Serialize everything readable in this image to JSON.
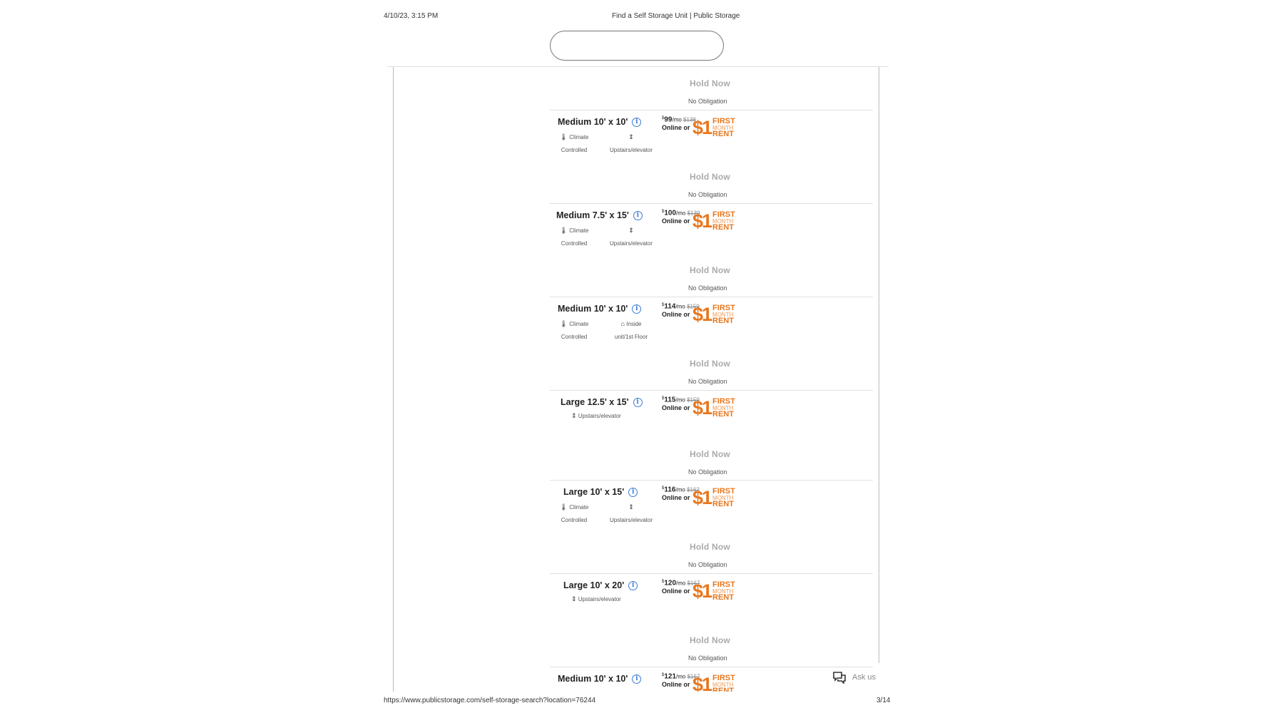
{
  "header": {
    "timestamp": "4/10/23, 3:15 PM",
    "page_title": "Find a Self Storage Unit | Public Storage"
  },
  "hold": {
    "button_label": "Hold Now",
    "sub_label": "No Obligation"
  },
  "promo": {
    "online_label": "Online or",
    "dollar_text": "$1",
    "line1": "FIRST",
    "line2": "MONTH",
    "line3": "RENT",
    "color": "#e8771e"
  },
  "units": [
    {
      "title": "Medium 10' x 10'",
      "price": "99",
      "per": "/mo",
      "was": "$138",
      "features": [
        {
          "icon": "thermometer-icon",
          "line1": "Climate",
          "line2": "Controlled"
        },
        {
          "icon": "stairs-icon",
          "line1": "",
          "line2": "Upstairs/elevator"
        }
      ]
    },
    {
      "title": "Medium 7.5' x 15'",
      "price": "100",
      "per": "/mo",
      "was": "$139",
      "features": [
        {
          "icon": "thermometer-icon",
          "line1": "Climate",
          "line2": "Controlled"
        },
        {
          "icon": "stairs-icon",
          "line1": "",
          "line2": "Upstairs/elevator"
        }
      ]
    },
    {
      "title": "Medium 10' x 10'",
      "price": "114",
      "per": "/mo",
      "was": "$159",
      "features": [
        {
          "icon": "thermometer-icon",
          "line1": "Climate",
          "line2": "Controlled"
        },
        {
          "icon": "home-icon",
          "line1": "Inside",
          "line2": "unit/1st Floor"
        }
      ]
    },
    {
      "title": "Large 12.5' x 15'",
      "price": "115",
      "per": "/mo",
      "was": "$159",
      "features": [
        {
          "icon": "stairs-icon",
          "line1": "Upstairs/elevator",
          "line2": ""
        }
      ]
    },
    {
      "title": "Large 10' x 15'",
      "price": "116",
      "per": "/mo",
      "was": "$162",
      "features": [
        {
          "icon": "thermometer-icon",
          "line1": "Climate",
          "line2": "Controlled"
        },
        {
          "icon": "stairs-icon",
          "line1": "",
          "line2": "Upstairs/elevator"
        }
      ]
    },
    {
      "title": "Large 10' x 20'",
      "price": "120",
      "per": "/mo",
      "was": "$167",
      "features": [
        {
          "icon": "stairs-icon",
          "line1": "Upstairs/elevator",
          "line2": ""
        }
      ]
    },
    {
      "title": "Medium 10' x 10'",
      "price": "121",
      "per": "/mo",
      "was": "$167",
      "features": []
    }
  ],
  "chat": {
    "label": "Ask us",
    "icon": "chat-icon"
  },
  "footer": {
    "url": "https://www.publicstorage.com/self-storage-search?location=76244",
    "page": "3/14"
  }
}
